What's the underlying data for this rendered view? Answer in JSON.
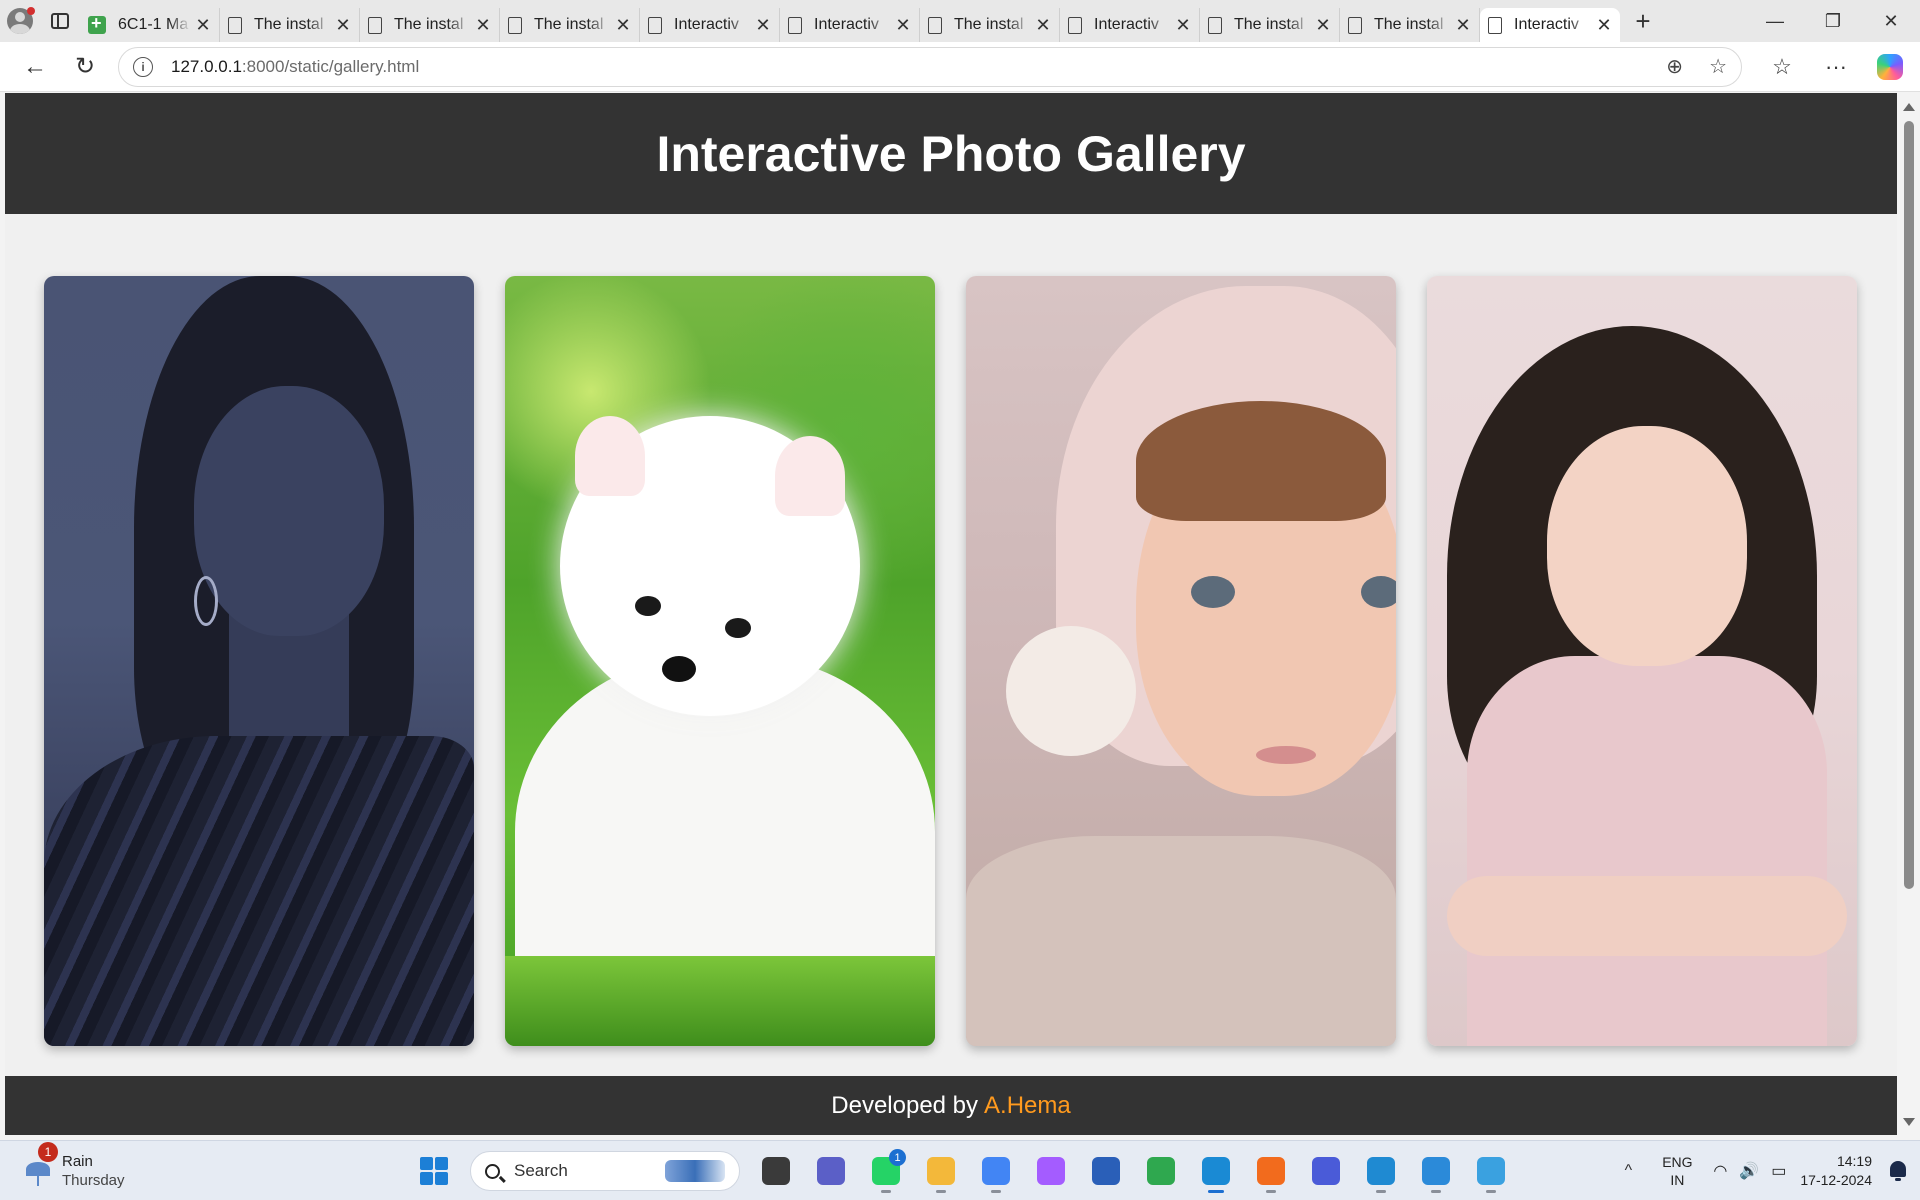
{
  "browser": {
    "tabs": [
      {
        "label": "6C1-1 Ma",
        "icon": "sheets-icon",
        "active": false
      },
      {
        "label": "The instal",
        "icon": "page-icon",
        "active": false
      },
      {
        "label": "The instal",
        "icon": "page-icon",
        "active": false
      },
      {
        "label": "The instal",
        "icon": "page-icon",
        "active": false
      },
      {
        "label": "Interactiv",
        "icon": "page-icon",
        "active": false
      },
      {
        "label": "Interactiv",
        "icon": "page-icon",
        "active": false
      },
      {
        "label": "The instal",
        "icon": "page-icon",
        "active": false
      },
      {
        "label": "Interactiv",
        "icon": "page-icon",
        "active": false
      },
      {
        "label": "The instal",
        "icon": "page-icon",
        "active": false
      },
      {
        "label": "The instal",
        "icon": "page-icon",
        "active": false
      },
      {
        "label": "Interactiv",
        "icon": "page-icon",
        "active": true
      }
    ],
    "close_glyph": "✕",
    "new_tab_glyph": "+",
    "window": {
      "minimize": "—",
      "restore": "❐",
      "close": "✕"
    },
    "url_host": "127.0.0.1",
    "url_path": ":8000/static/gallery.html",
    "nav": {
      "back": "←",
      "reload": "↻"
    },
    "addr_icons": {
      "info": "i",
      "zoom": "⊕",
      "favorite": "☆"
    },
    "toolbar_icons": {
      "favorites": "☆",
      "more": "···"
    }
  },
  "page": {
    "title": "Interactive Photo Gallery",
    "photos": [
      {
        "subject": "woman-portrait"
      },
      {
        "subject": "white-puppy"
      },
      {
        "subject": "baby-pink-hat"
      },
      {
        "subject": "girl-pink-dress"
      }
    ],
    "footer_prefix": "Developed by",
    "footer_author": "A.Hema",
    "colors": {
      "header_bg": "#333333",
      "author": "#ff9a1e",
      "page_bg": "#f0f0f0"
    }
  },
  "taskbar": {
    "weather": {
      "badge": "1",
      "condition": "Rain",
      "day": "Thursday"
    },
    "search_placeholder": "Search",
    "apps": [
      {
        "name": "file-manager-icon",
        "color": "#3a3a3a",
        "running": false
      },
      {
        "name": "teams-icon",
        "color": "#5b5fc7",
        "running": false
      },
      {
        "name": "whatsapp-icon",
        "color": "#25d366",
        "running": true,
        "badge": "1"
      },
      {
        "name": "file-explorer-icon",
        "color": "#f3b83a",
        "running": true
      },
      {
        "name": "chrome-icon",
        "color": "#4285f4",
        "running": true
      },
      {
        "name": "copilot-icon",
        "color": "#a45cff",
        "running": false
      },
      {
        "name": "store-icon",
        "color": "#2a5fb8",
        "running": false
      },
      {
        "name": "sync-icon",
        "color": "#2fa84f",
        "running": false
      },
      {
        "name": "edge-icon",
        "color": "#1a8ad4",
        "running": true,
        "active": true
      },
      {
        "name": "fox-app-icon",
        "color": "#f26b1d",
        "running": true
      },
      {
        "name": "vpn-icon",
        "color": "#4a5bd8",
        "running": false
      },
      {
        "name": "vscode-icon",
        "color": "#1f8ad2",
        "running": true
      },
      {
        "name": "paint-icon",
        "color": "#2b8ad9",
        "running": true
      },
      {
        "name": "notepad-icon",
        "color": "#3aa1e0",
        "running": true
      }
    ],
    "tray": {
      "chevron": "^",
      "lang_line1": "ENG",
      "lang_line2": "IN",
      "wifi": "◠",
      "volume": "🔊",
      "battery": "▭",
      "time": "14:19",
      "date": "17-12-2024"
    }
  }
}
